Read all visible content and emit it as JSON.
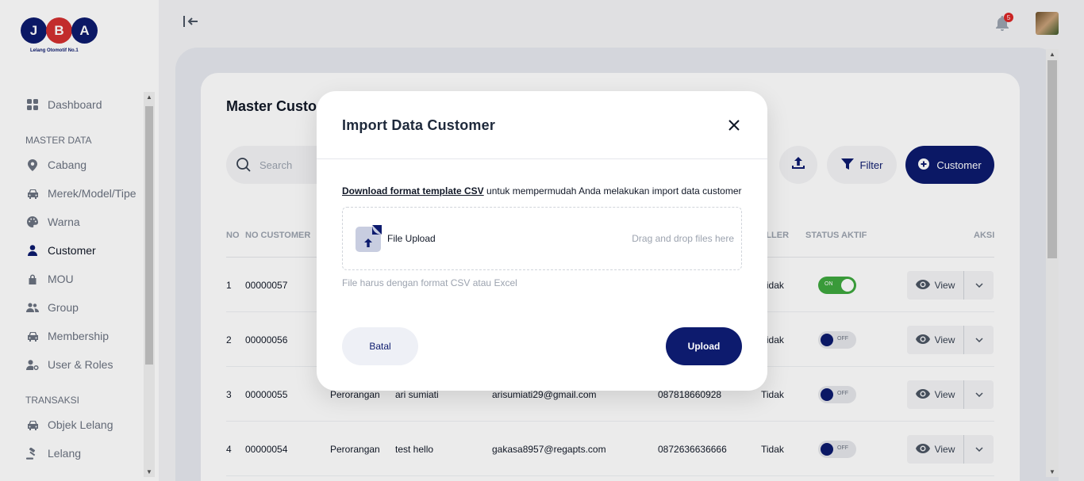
{
  "logo": {
    "letters": [
      "J",
      "B",
      "A"
    ],
    "tagline": "Lelang Otomotif No.1"
  },
  "sidebar": {
    "top_items": [
      {
        "label": "Dashboard",
        "icon": "grid-icon"
      }
    ],
    "sections": [
      {
        "title": "MASTER DATA",
        "items": [
          {
            "label": "Cabang",
            "icon": "location-pin-icon"
          },
          {
            "label": "Merek/Model/Tipe",
            "icon": "car-icon"
          },
          {
            "label": "Warna",
            "icon": "palette-icon"
          },
          {
            "label": "Customer",
            "icon": "person-icon",
            "active": true
          },
          {
            "label": "MOU",
            "icon": "lock-icon"
          },
          {
            "label": "Group",
            "icon": "users-icon"
          },
          {
            "label": "Membership",
            "icon": "car-icon"
          },
          {
            "label": "User & Roles",
            "icon": "user-settings-icon"
          }
        ]
      },
      {
        "title": "TRANSAKSI",
        "items": [
          {
            "label": "Objek Lelang",
            "icon": "car-icon"
          },
          {
            "label": "Lelang",
            "icon": "gavel-icon"
          }
        ]
      }
    ]
  },
  "topbar": {
    "notification_count": "5"
  },
  "page": {
    "title": "Master Custo",
    "search_placeholder": "Search",
    "filter_label": "Filter",
    "add_customer_label": "Customer"
  },
  "table": {
    "headers": {
      "no": "NO",
      "no_customer": "NO CUSTOMER",
      "reseller": "ELLER",
      "status_aktif": "STATUS AKTIF",
      "aksi": "AKSI"
    },
    "rows": [
      {
        "no": "1",
        "no_customer": "00000057",
        "tipe": "",
        "nama": "",
        "email": "",
        "telepon": "",
        "reseller": "Tidak",
        "status": "ON",
        "active": true,
        "view_label": "View"
      },
      {
        "no": "2",
        "no_customer": "00000056",
        "tipe": "",
        "nama": "",
        "email": "",
        "telepon": "",
        "reseller": "Tidak",
        "status": "OFF",
        "active": false,
        "view_label": "View"
      },
      {
        "no": "3",
        "no_customer": "00000055",
        "tipe": "Perorangan",
        "nama": "ari sumiati",
        "email": "arisumiati29@gmail.com",
        "telepon": "087818660928",
        "reseller": "Tidak",
        "status": "OFF",
        "active": false,
        "view_label": "View"
      },
      {
        "no": "4",
        "no_customer": "00000054",
        "tipe": "Perorangan",
        "nama": "test hello",
        "email": "gakasa8957@regapts.com",
        "telepon": "0872636636666",
        "reseller": "Tidak",
        "status": "OFF",
        "active": false,
        "view_label": "View"
      }
    ]
  },
  "modal": {
    "title": "Import Data Customer",
    "download_link": "Download format template CSV",
    "info_text": " untuk mempermudah Anda melakukan import data customer",
    "file_upload_label": "File Upload",
    "drop_hint": "Drag and drop files here",
    "note": "File harus dengan format CSV atau Excel",
    "cancel_label": "Batal",
    "upload_label": "Upload"
  },
  "colors": {
    "primary": "#0d1b6e",
    "danger": "#d32f2f",
    "success": "#3ea83e"
  }
}
